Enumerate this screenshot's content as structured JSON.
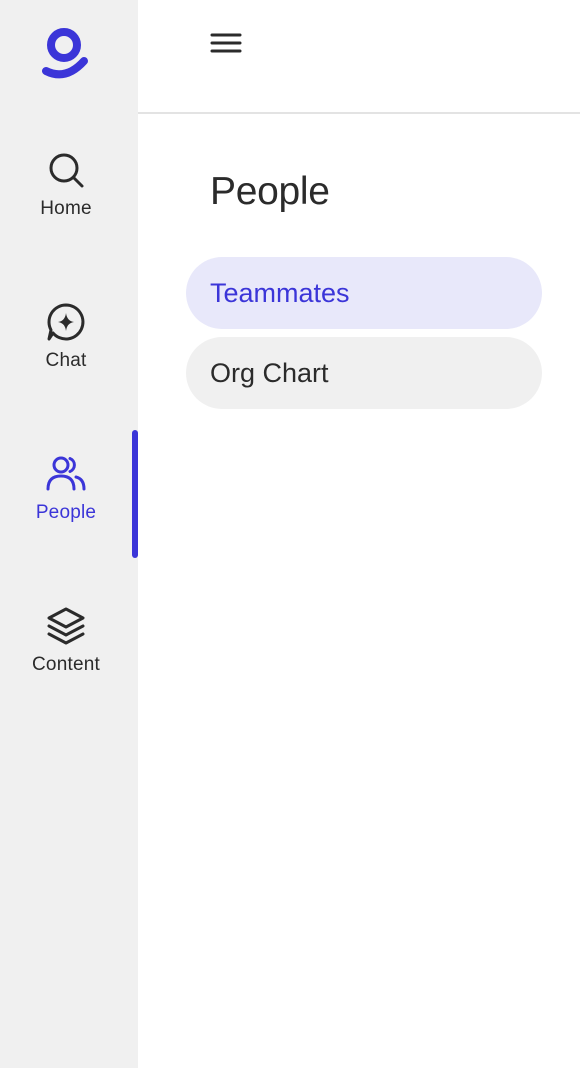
{
  "colors": {
    "accent": "#3b35d8",
    "sidebar_bg": "#f0f0f0",
    "active_pill_bg": "#e8e8fa",
    "inactive_pill_bg": "#f0f0f0",
    "text": "#2b2b2b"
  },
  "sidebar": {
    "logo_icon": "brand-g-logo",
    "items": [
      {
        "label": "Home",
        "icon": "search-icon",
        "active": false
      },
      {
        "label": "Chat",
        "icon": "chat-sparkle-icon",
        "active": false
      },
      {
        "label": "People",
        "icon": "people-icon",
        "active": true
      },
      {
        "label": "Content",
        "icon": "layers-icon",
        "active": false
      }
    ]
  },
  "header": {
    "menu_icon": "hamburger-menu-icon"
  },
  "main": {
    "title": "People",
    "tabs": [
      {
        "label": "Teammates",
        "selected": true
      },
      {
        "label": "Org Chart",
        "selected": false
      }
    ]
  }
}
